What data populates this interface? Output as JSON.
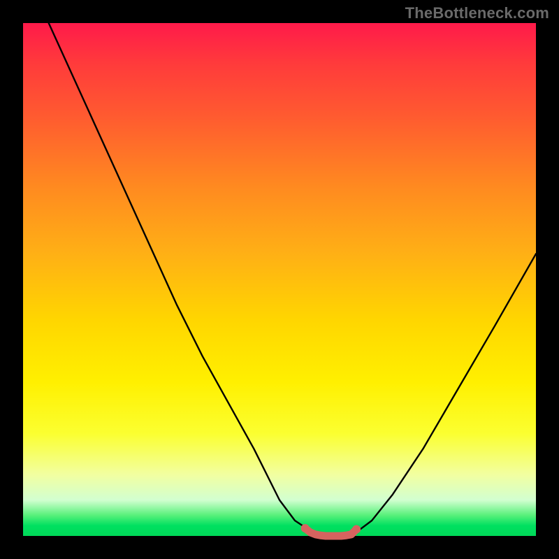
{
  "watermark": "TheBottleneck.com",
  "chart_data": {
    "type": "line",
    "title": "",
    "xlabel": "",
    "ylabel": "",
    "xlim": [
      0,
      100
    ],
    "ylim": [
      0,
      100
    ],
    "grid": false,
    "legend": false,
    "series": [
      {
        "name": "bottleneck-curve",
        "color": "#000000",
        "x": [
          5,
          10,
          15,
          20,
          25,
          30,
          35,
          40,
          45,
          48,
          50,
          53,
          56,
          59,
          62,
          64,
          68,
          72,
          78,
          85,
          92,
          100
        ],
        "y": [
          100,
          89,
          78,
          67,
          56,
          45,
          35,
          26,
          17,
          11,
          7,
          3,
          1,
          0,
          0,
          0,
          3,
          8,
          17,
          29,
          41,
          55
        ]
      },
      {
        "name": "optimal-region",
        "color": "#d6635f",
        "x": [
          55,
          56,
          57,
          58,
          59,
          60,
          61,
          62,
          63,
          64,
          65
        ],
        "y": [
          1.5,
          0.7,
          0.3,
          0.1,
          0,
          0,
          0,
          0,
          0.1,
          0.3,
          1.3
        ]
      }
    ],
    "background_gradient": {
      "top": "#ff1a4a",
      "mid": "#fff000",
      "bottom": "#00d858"
    }
  }
}
